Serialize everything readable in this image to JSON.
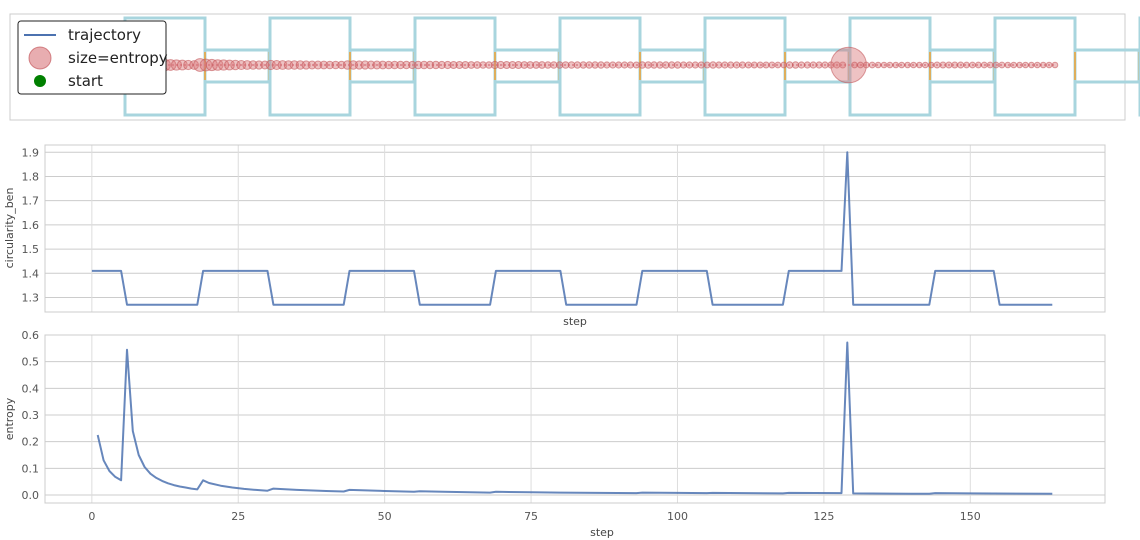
{
  "chart_data": [
    {
      "type": "line",
      "panel": "trajectory",
      "legend": {
        "placement": "top-left",
        "entries": [
          {
            "label": "trajectory",
            "marker": "line",
            "color": "#4c72b0"
          },
          {
            "label": "size=entropy",
            "marker": "circle",
            "color": "#d9777b"
          },
          {
            "label": "start",
            "marker": "dot",
            "color": "#008000"
          }
        ]
      },
      "cells": {
        "count": 7,
        "outline_color": "#a8d5de",
        "connector_color": "#f0a030"
      },
      "path_color": "#d98090",
      "grid": false
    },
    {
      "type": "line",
      "panel": "circularity",
      "xlabel": "step",
      "ylabel": "circularity_ben",
      "xlim": [
        -8,
        173
      ],
      "ylim": [
        1.24,
        1.93
      ],
      "yticks": [
        "1.3",
        "1.4",
        "1.5",
        "1.6",
        "1.7",
        "1.8",
        "1.9"
      ],
      "ytick_values": [
        1.3,
        1.4,
        1.5,
        1.6,
        1.7,
        1.8,
        1.9
      ],
      "xgrid": [
        0,
        25,
        50,
        75,
        100,
        125,
        150
      ],
      "grid": true,
      "series": [
        {
          "color": "#4c72b0",
          "x": [
            0,
            5,
            6,
            18,
            19,
            30,
            31,
            43,
            44,
            55,
            56,
            68,
            69,
            80,
            81,
            93,
            94,
            105,
            106,
            118,
            119,
            128,
            129,
            130,
            143,
            144,
            154,
            155,
            164
          ],
          "y": [
            1.41,
            1.41,
            1.27,
            1.27,
            1.41,
            1.41,
            1.27,
            1.27,
            1.41,
            1.41,
            1.27,
            1.27,
            1.41,
            1.41,
            1.27,
            1.27,
            1.41,
            1.41,
            1.27,
            1.27,
            1.41,
            1.41,
            1.9,
            1.27,
            1.27,
            1.41,
            1.41,
            1.27,
            1.27
          ]
        }
      ]
    },
    {
      "type": "line",
      "panel": "entropy",
      "xlabel": "step",
      "ylabel": "entropy",
      "xlim": [
        -8,
        173
      ],
      "ylim": [
        -0.03,
        0.6
      ],
      "xticks": [
        "0",
        "25",
        "50",
        "75",
        "100",
        "125",
        "150"
      ],
      "xtick_values": [
        0,
        25,
        50,
        75,
        100,
        125,
        150
      ],
      "yticks": [
        "0.0",
        "0.1",
        "0.2",
        "0.3",
        "0.4",
        "0.5",
        "0.6"
      ],
      "ytick_values": [
        0.0,
        0.1,
        0.2,
        0.3,
        0.4,
        0.5,
        0.6
      ],
      "grid": true,
      "series": [
        {
          "color": "#4c72b0",
          "x": [
            1,
            2,
            3,
            4,
            5,
            6,
            7,
            8,
            9,
            10,
            11,
            12,
            13,
            14,
            15,
            16,
            17,
            18,
            19,
            20,
            22,
            24,
            26,
            28,
            30,
            31,
            35,
            40,
            43,
            44,
            50,
            55,
            56,
            60,
            68,
            69,
            75,
            80,
            93,
            94,
            100,
            105,
            106,
            118,
            119,
            128,
            129,
            130,
            140,
            143,
            144,
            150,
            164
          ],
          "y": [
            0.225,
            0.13,
            0.09,
            0.068,
            0.055,
            0.545,
            0.24,
            0.15,
            0.105,
            0.08,
            0.064,
            0.053,
            0.044,
            0.037,
            0.032,
            0.028,
            0.024,
            0.021,
            0.055,
            0.045,
            0.035,
            0.028,
            0.023,
            0.019,
            0.016,
            0.024,
            0.019,
            0.015,
            0.013,
            0.019,
            0.015,
            0.012,
            0.014,
            0.012,
            0.009,
            0.012,
            0.01,
            0.009,
            0.007,
            0.009,
            0.008,
            0.007,
            0.008,
            0.006,
            0.008,
            0.007,
            0.572,
            0.006,
            0.005,
            0.005,
            0.007,
            0.006,
            0.005
          ]
        }
      ]
    }
  ]
}
